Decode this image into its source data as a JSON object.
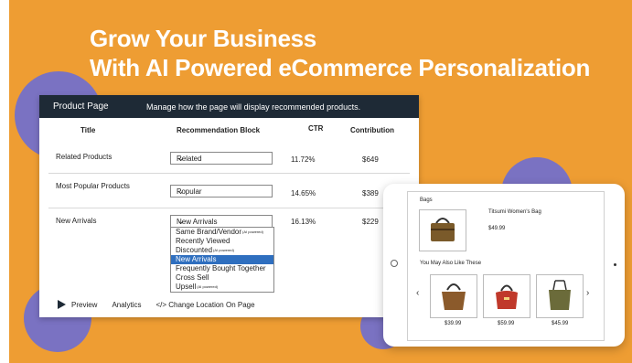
{
  "headline": {
    "line1": "Grow Your Business",
    "line2": "With AI Powered eCommerce Personalization"
  },
  "panel": {
    "title": "Product Page",
    "subtitle": "Manage how the page will display recommended products.",
    "columns": {
      "title": "Title",
      "block": "Recommendation Block",
      "ctr": "CTR",
      "contribution": "Contribution"
    },
    "rows": [
      {
        "title": "Related Products",
        "block": "Related",
        "ctr": "11.72%",
        "contribution": "$649"
      },
      {
        "title": "Most Popular Products",
        "block": "Popular",
        "ctr": "14.65%",
        "contribution": "$389"
      },
      {
        "title": "New Arrivals",
        "block": "New Arrivals",
        "ctr": "16.13%",
        "contribution": "$229"
      }
    ],
    "dropdown": {
      "ai_tag": "(AI powered)",
      "options": [
        "Same Brand/Vendor",
        "Recently Viewed",
        "Discounted",
        "New Arrivals",
        "Frequently Bought Together",
        "Cross Sell",
        "Upsell"
      ],
      "selected_index": 3
    },
    "footer": {
      "preview": "Preview",
      "analytics": "Analytics",
      "change_location": "</> Change Location On Page"
    }
  },
  "tablet": {
    "category": "Bags",
    "product_name": "Titsumi Women's Bag",
    "product_price": "$49.99",
    "also_like": "You May Also Like These",
    "recommendations": [
      {
        "price": "$39.99",
        "color": "#8b5a2b"
      },
      {
        "price": "$59.99",
        "color": "#c0392b"
      },
      {
        "price": "$45.99",
        "color": "#6b6b3a"
      }
    ],
    "main_bag_color": "#7a5a2a"
  },
  "colors": {
    "background": "#ee9d33",
    "blob": "#7a72c2",
    "panel_header": "#1e2a36",
    "selected_option": "#2f6fbf"
  }
}
